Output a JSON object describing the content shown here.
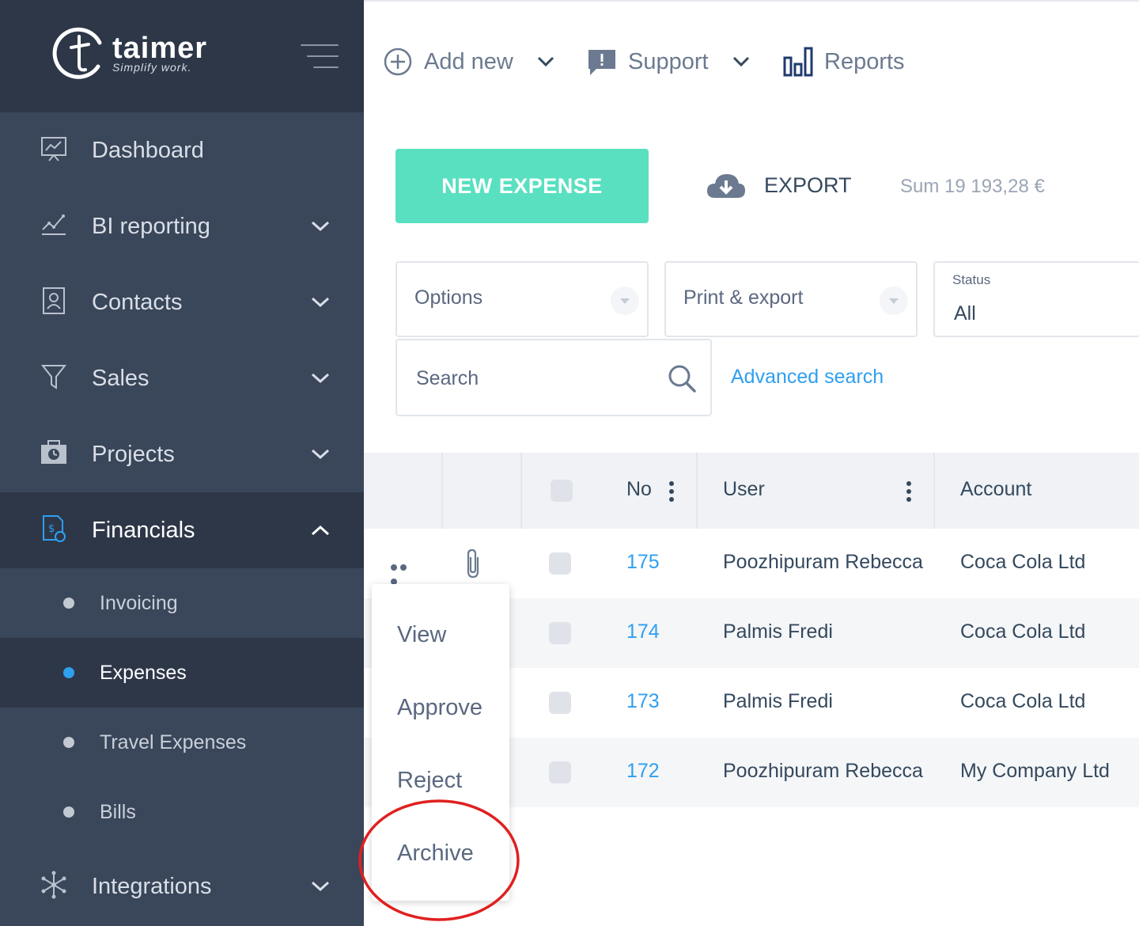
{
  "brand": {
    "name": "taimer",
    "tagline": "Simplify work."
  },
  "sidebar": {
    "items": [
      {
        "label": "Dashboard",
        "icon": "dashboard-icon",
        "has_chevron": false
      },
      {
        "label": "BI reporting",
        "icon": "line-chart-icon",
        "has_chevron": true
      },
      {
        "label": "Contacts",
        "icon": "contacts-book-icon",
        "has_chevron": true
      },
      {
        "label": "Sales",
        "icon": "funnel-icon",
        "has_chevron": true
      },
      {
        "label": "Projects",
        "icon": "briefcase-clock-icon",
        "has_chevron": true
      },
      {
        "label": "Financials",
        "icon": "invoice-icon",
        "has_chevron": true,
        "expanded": true,
        "active": true
      }
    ],
    "sub_items": [
      {
        "label": "Invoicing"
      },
      {
        "label": "Expenses",
        "active": true
      },
      {
        "label": "Travel Expenses"
      },
      {
        "label": "Bills"
      }
    ],
    "bottom_item": {
      "label": "Integrations",
      "icon": "integrations-icon"
    }
  },
  "topbar": {
    "add_new": "Add new",
    "support": "Support",
    "reports": "Reports"
  },
  "toolbar": {
    "new_expense": "NEW EXPENSE",
    "export": "EXPORT",
    "sum": "Sum 19 193,28 €"
  },
  "filters": {
    "options": "Options",
    "print_export": "Print & export",
    "status_caption": "Status",
    "status_value": "All",
    "search_placeholder": "Search",
    "advanced_search": "Advanced search"
  },
  "table": {
    "columns": {
      "no": "No",
      "user": "User",
      "account": "Account"
    },
    "rows": [
      {
        "no": "175",
        "user": "Poozhipuram Rebecca",
        "account": "Coca Cola Ltd"
      },
      {
        "no": "174",
        "user": "Palmis Fredi",
        "account": "Coca Cola Ltd"
      },
      {
        "no": "173",
        "user": "Palmis Fredi",
        "account": "Coca Cola Ltd"
      },
      {
        "no": "172",
        "user": "Poozhipuram Rebecca",
        "account": "My Company Ltd"
      }
    ]
  },
  "context_menu": {
    "items": [
      "View",
      "Approve",
      "Reject",
      "Archive"
    ],
    "highlighted": "Archive"
  },
  "colors": {
    "sidebar_bg": "#3a4659",
    "sidebar_dark": "#2d3748",
    "accent_teal": "#59e0c0",
    "link_blue": "#2f9ff0",
    "highlight_red": "#e02020"
  }
}
